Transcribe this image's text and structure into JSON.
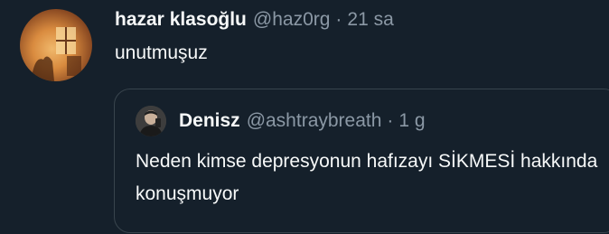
{
  "tweet": {
    "display_name": "hazar klasoğlu",
    "handle": "@haz0rg",
    "separator": "·",
    "time": "21 sa",
    "text": "unutmuşuz",
    "avatar_icon": "user-avatar-photo"
  },
  "quote": {
    "display_name": "Denisz",
    "handle": "@ashtraybreath",
    "separator": "·",
    "time": "1 g",
    "text": "Neden kimse depresyonun hafızayı SİKMESİ hakkında konuşmuyor",
    "avatar_icon": "user-avatar-photo"
  },
  "colors": {
    "background": "#15202b",
    "primary_text": "#f7f9f9",
    "secondary_text": "#8b98a5",
    "border": "#38444d"
  }
}
